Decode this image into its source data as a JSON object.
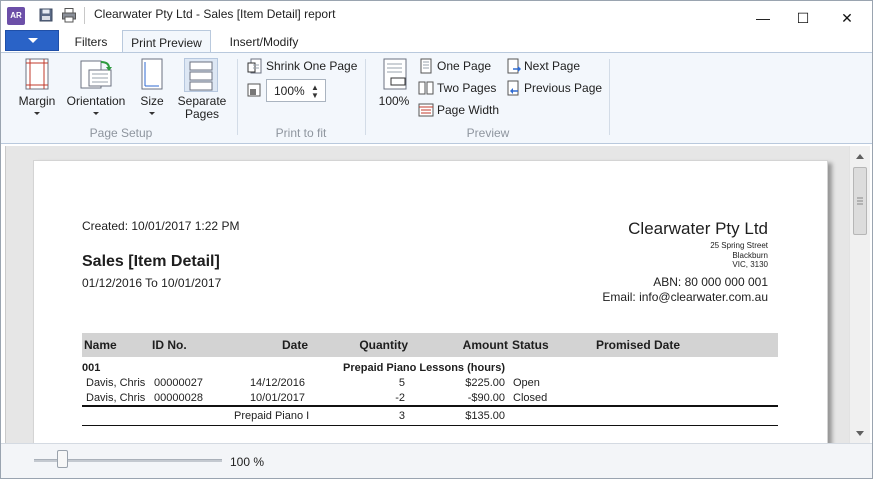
{
  "window": {
    "title": "Clearwater Pty Ltd - Sales [Item Detail] report",
    "app_icon_text": "AR",
    "controls": {
      "minimize": "—",
      "maximize": "☐",
      "close": "✕"
    }
  },
  "tabs": [
    {
      "label": "Filters",
      "active": false
    },
    {
      "label": "Print Preview",
      "active": true
    },
    {
      "label": "Insert/Modify",
      "active": false
    }
  ],
  "ribbon": {
    "page_setup": {
      "group_label": "Page Setup",
      "margin": "Margin",
      "orientation": "Orientation",
      "size": "Size",
      "separate_pages_1": "Separate",
      "separate_pages_2": "Pages"
    },
    "print_to_fit": {
      "group_label": "Print to fit",
      "shrink_one_page": "Shrink One Page",
      "zoom_value": "100%"
    },
    "preview": {
      "group_label": "Preview",
      "zoom_100": "100%",
      "one_page": "One Page",
      "two_pages": "Two Pages",
      "page_width": "Page Width",
      "next_page": "Next Page",
      "previous_page": "Previous Page"
    }
  },
  "report": {
    "created": "Created: 10/01/2017 1:22 PM",
    "title": "Sales [Item Detail]",
    "date_range": "01/12/2016 To 10/01/2017",
    "company": {
      "name": "Clearwater Pty Ltd",
      "address1": "25 Spring Street",
      "address2": "Blackburn",
      "address3": "VIC, 3130",
      "abn": "ABN: 80 000 000 001",
      "email": "Email: info@clearwater.com.au"
    },
    "columns": {
      "name": "Name",
      "id_no": "ID No.",
      "date": "Date",
      "quantity": "Quantity",
      "amount": "Amount",
      "status": "Status",
      "promised_date": "Promised Date"
    },
    "group": {
      "code": "001",
      "item_name": "Prepaid Piano Lessons (hours)"
    },
    "rows": [
      {
        "name": "Davis, Chris",
        "id": "00000027",
        "date": "14/12/2016",
        "quantity": "5",
        "amount": "$225.00",
        "status": "Open"
      },
      {
        "name": "Davis, Chris",
        "id": "00000028",
        "date": "10/01/2017",
        "quantity": "-2",
        "amount": "-$90.00",
        "status": "Closed"
      }
    ],
    "subtotal": {
      "label": "Prepaid Piano I",
      "quantity": "3",
      "amount": "$135.00"
    }
  },
  "statusbar": {
    "zoom_label": "100 %",
    "zoom_fraction": 0.15
  },
  "colors": {
    "ribbon_bg": "#f3f7fc",
    "app_menu": "#2a63c7",
    "header_row_bg": "#d3d3d3",
    "preview_bg": "#e6e6e6"
  }
}
